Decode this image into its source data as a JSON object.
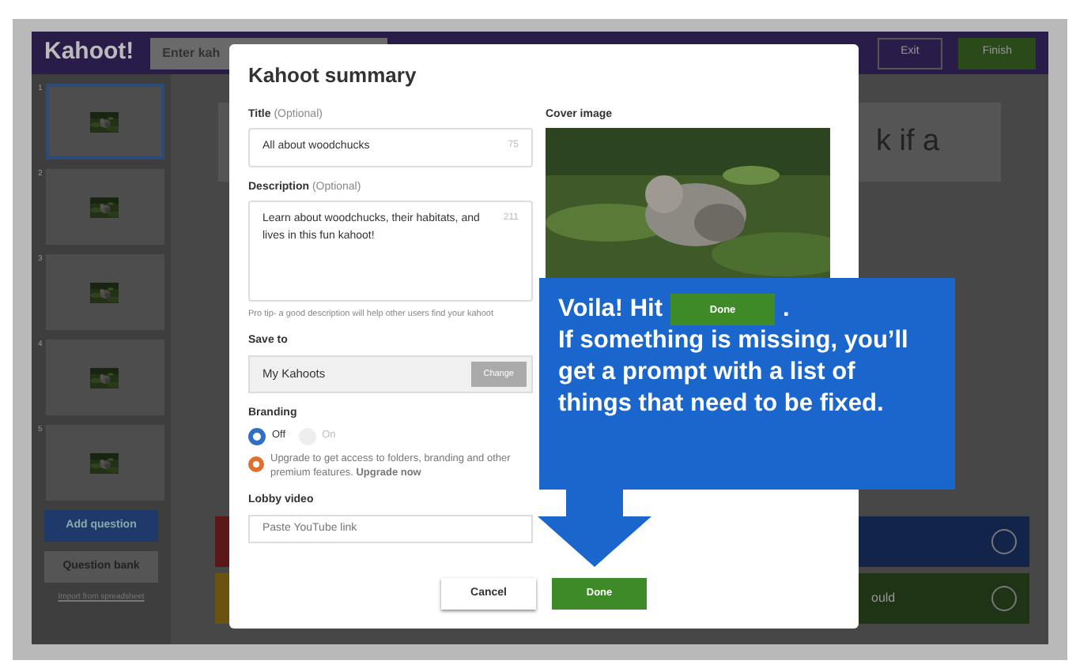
{
  "app": {
    "logo": "Kahoot!",
    "search": "Enter kah",
    "buttons": [
      "Exit",
      "Finish"
    ]
  },
  "sidebar": {
    "slides": [
      {
        "number": "1",
        "selected": true
      },
      {
        "number": "2",
        "selected": false
      },
      {
        "number": "3",
        "selected": false
      },
      {
        "number": "4",
        "selected": false
      },
      {
        "number": "5",
        "selected": false
      }
    ],
    "add_button": "Add question",
    "bank_button": "Question bank",
    "import_link": "Import from spreadsheet"
  },
  "background": {
    "question_fragment": "k if a",
    "answer_fragment": "ould"
  },
  "modal": {
    "title": "Kahoot summary",
    "title_field": {
      "label": "Title",
      "optional": "(Optional)",
      "value": "All about woodchucks",
      "count": "75"
    },
    "description_field": {
      "label": "Description",
      "optional": "(Optional)",
      "value": "Learn about woodchucks, their habitats, and lives in this fun kahoot!",
      "count": "211"
    },
    "tip": "Pro tip- a good description will help other users find your kahoot",
    "save_to": {
      "label": "Save to",
      "value": "My Kahoots",
      "button": "Change"
    },
    "branding": {
      "label": "Branding",
      "options": [
        {
          "label": "Off",
          "selected": true
        },
        {
          "label": "On",
          "selected": false
        }
      ],
      "upgrade_text": "Upgrade to get access to folders, branding and other premium features.",
      "upgrade_link": "Upgrade now"
    },
    "lobby_video": {
      "label": "Lobby video",
      "placeholder": "Paste YouTube link"
    },
    "cover_label": "Cover image",
    "cancel": "Cancel",
    "done": "Done"
  },
  "callout": {
    "lead": "Voila! Hit",
    "button": "Done",
    "period": ".",
    "body": "If something is missing, you’ll get a prompt with a list of things that need to be fixed."
  }
}
